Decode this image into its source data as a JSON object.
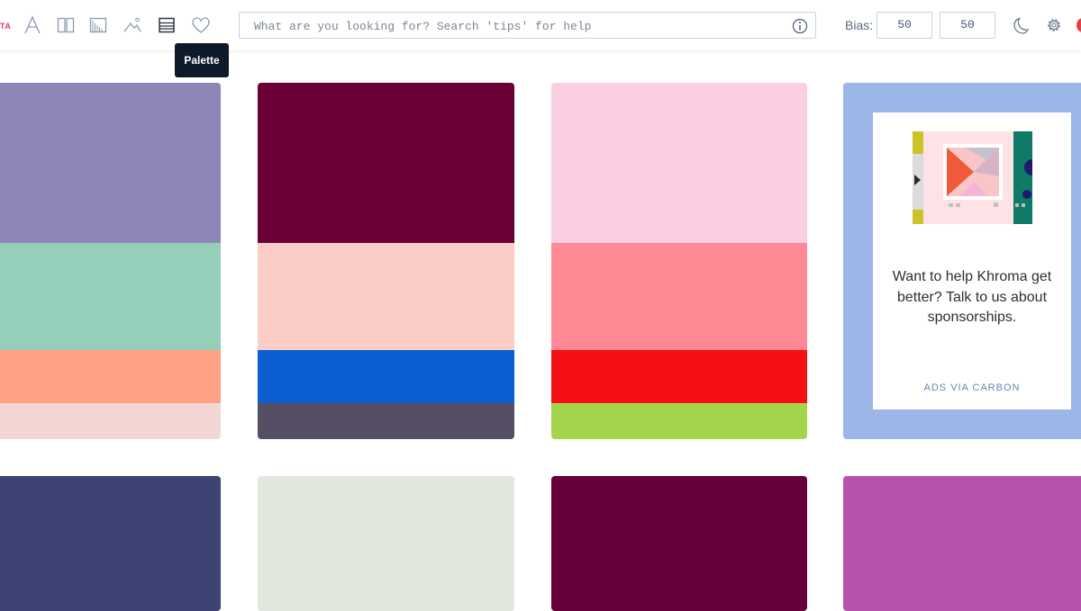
{
  "toolbar": {
    "logo_fragment": "TA",
    "icons": [
      "typography-icon",
      "split-view-icon",
      "gradient-icon",
      "image-icon",
      "palette-icon",
      "heart-icon"
    ],
    "search": {
      "placeholder": "What are you looking for? Search 'tips' for help",
      "value": ""
    },
    "bias_label": "Bias:",
    "bias_values": [
      "50",
      "50"
    ]
  },
  "tooltip": {
    "text": "Palette"
  },
  "palettes": [
    {
      "colors": [
        "#8e86b6",
        "#95cfba",
        "#fea084",
        "#f1d6d3"
      ]
    },
    {
      "colors": [
        "#6a0036",
        "#fbcdc6",
        "#0d5ed2",
        "#554e65"
      ]
    },
    {
      "colors": [
        "#fbcfe1",
        "#fe8893",
        "#f51013",
        "#a4d44b"
      ]
    },
    {
      "colors": [
        "#3d4473"
      ]
    },
    {
      "colors": [
        "#e0e8de"
      ]
    },
    {
      "colors": [
        "#67003a"
      ]
    },
    {
      "colors": [
        "#b752ab"
      ]
    }
  ],
  "ad": {
    "text": "Want to help Khroma get better? Talk to us about sponsorships.",
    "link": "ADS VIA CARBON"
  }
}
